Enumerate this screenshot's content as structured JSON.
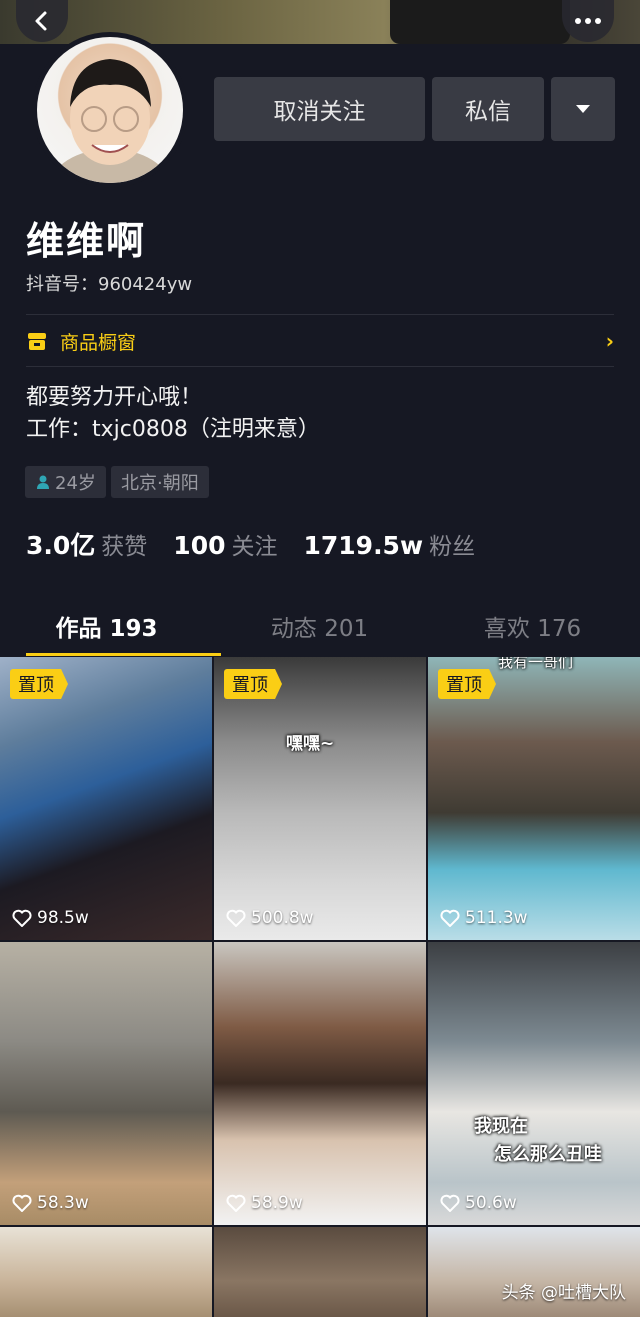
{
  "profile": {
    "name": "维维啊",
    "douyin_id": "抖音号：960424yw",
    "shop_label": "商品橱窗",
    "bio_line1": "都要努力开心哦！",
    "bio_line2": "工作：txjc0808（注明来意）",
    "tags": [
      "24岁",
      "北京·朝阳"
    ]
  },
  "actions": {
    "unfollow": "取消关注",
    "message": "私信"
  },
  "stats": [
    {
      "value": "3.0亿",
      "label": "获赞"
    },
    {
      "value": "100",
      "label": "关注"
    },
    {
      "value": "1719.5w",
      "label": "粉丝"
    }
  ],
  "tabs": [
    "作品 193",
    "动态 201",
    "喜欢 176"
  ],
  "videos": [
    {
      "pinned": "置顶",
      "likes": "98.5w",
      "overlay": ""
    },
    {
      "pinned": "置顶",
      "likes": "500.8w",
      "overlay": "嘿嘿~"
    },
    {
      "pinned": "置顶",
      "likes": "511.3w",
      "overlay": "我有一哥们"
    },
    {
      "pinned": "",
      "likes": "58.3w",
      "overlay": ""
    },
    {
      "pinned": "",
      "likes": "58.9w",
      "overlay": ""
    },
    {
      "pinned": "",
      "likes": "50.6w",
      "overlay": "我现在",
      "overlay2": "怎么那么丑哇"
    }
  ],
  "watermark": "头条 @吐槽大队",
  "colors": {
    "accent": "#face15",
    "background": "#161823"
  }
}
